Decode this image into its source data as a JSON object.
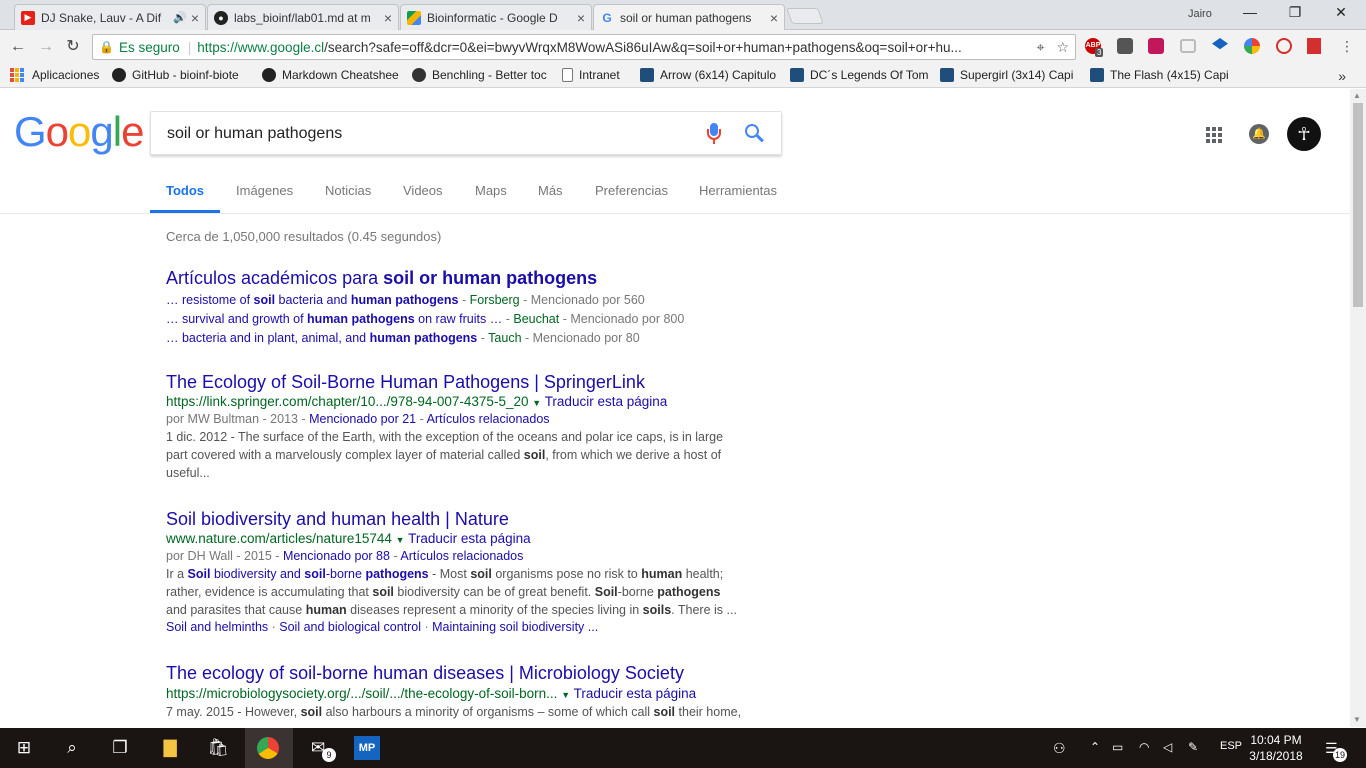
{
  "browser": {
    "tabs": [
      {
        "title": "DJ Snake, Lauv - A Dif",
        "icon": "youtube-icon"
      },
      {
        "title": "labs_bioinf/lab01.md at m",
        "icon": "github-icon"
      },
      {
        "title": "Bioinformatic - Google D",
        "icon": "google-drive-icon"
      },
      {
        "title": "soil or human pathogens",
        "icon": "google-icon"
      }
    ],
    "user": "Jairo",
    "secure_label": "Es seguro",
    "url_host": "https://www.google.cl",
    "url_rest": "/search?safe=off&dcr=0&ei=bwyvWrqxM8WowASi86uIAw&q=soil+or+human+pathogens&oq=soil+or+hu...",
    "extensions": [
      {
        "label": "ABP",
        "badge": "3"
      }
    ],
    "bookmarks": [
      {
        "label": "Aplicaciones"
      },
      {
        "label": "GitHub - bioinf-biote"
      },
      {
        "label": "Markdown Cheatshee"
      },
      {
        "label": "Benchling - Better toc"
      },
      {
        "label": "Intranet"
      },
      {
        "label": "Arrow (6x14) Capitulo"
      },
      {
        "label": "DC´s Legends Of Tom"
      },
      {
        "label": "Supergirl (3x14) Capi"
      },
      {
        "label": "The Flash (4x15) Capi"
      }
    ]
  },
  "google": {
    "query": "soil or human pathogens",
    "nav_tabs": [
      "Todos",
      "Imágenes",
      "Noticias",
      "Videos",
      "Maps",
      "Más",
      "Preferencias",
      "Herramientas"
    ],
    "stats": "Cerca de 1,050,000 resultados (0.45 segundos)",
    "academic": {
      "title_prefix": "Artículos académicos para ",
      "title_query": "soil or human pathogens",
      "items": [
        {
          "pre": "… resistome of ",
          "b1": "soil",
          "mid": " bacteria and ",
          "b2": "human pathogens",
          "author": "Forsberg",
          "cites": "Mencionado por 560"
        },
        {
          "pre": "… survival and growth of ",
          "b1": "human pathogens",
          "mid": " on raw fruits …",
          "b2": "",
          "author": "Beuchat",
          "cites": "Mencionado por 800"
        },
        {
          "pre": "… bacteria and in plant, animal, and ",
          "b1": "human pathogens",
          "mid": "",
          "b2": "",
          "author": "Tauch",
          "cites": "Mencionado por 80"
        }
      ]
    },
    "results": [
      {
        "title": "The Ecology of Soil-Borne Human Pathogens | SpringerLink",
        "url": "https://link.springer.com/chapter/10.../978-94-007-4375-5_20",
        "translate": "Traducir esta página",
        "meta_author": "por MW Bultman - 2013 - ",
        "meta_cites": "Mencionado por 21",
        "meta_related": "Artículos relacionados",
        "snippet_1": "1 dic. 2012 - The surface of the Earth, with the exception of the oceans and polar ice caps, is in large",
        "snippet_2": "part covered with a marvelously complex layer of material called ",
        "snippet_2b": "soil",
        "snippet_2c": ", from which we derive a host of",
        "snippet_3": "useful..."
      },
      {
        "title": "Soil biodiversity and human health | Nature",
        "url": "www.nature.com/articles/nature15744",
        "translate": "Traducir esta página",
        "meta_author": "por DH Wall - 2015 - ",
        "meta_cites": "Mencionado por 88",
        "meta_related": "Artículos relacionados",
        "sitelinks": [
          "Soil and helminths",
          "Soil and biological control",
          "Maintaining soil biodiversity ..."
        ]
      },
      {
        "title": "The ecology of soil-borne human diseases | Microbiology Society",
        "url": "https://microbiologysociety.org/.../soil/.../the-ecology-of-soil-born...",
        "translate": "Traducir esta página",
        "snippet_1a": "7 may. 2015 - However, ",
        "snippet_1b": "soil",
        "snippet_1c": " also harbours a minority of organisms – some of which call ",
        "snippet_1d": "soil",
        "snippet_1e": " their home,"
      }
    ]
  },
  "taskbar": {
    "mail_badge": "9",
    "lang": "ESP",
    "time": "10:04 PM",
    "date": "3/18/2018",
    "notif_count": "19"
  },
  "colors": {
    "link": "#1a0dab",
    "url_green": "#006621",
    "google_blue": "#4285f4",
    "tab_active": "#1a73e8"
  }
}
